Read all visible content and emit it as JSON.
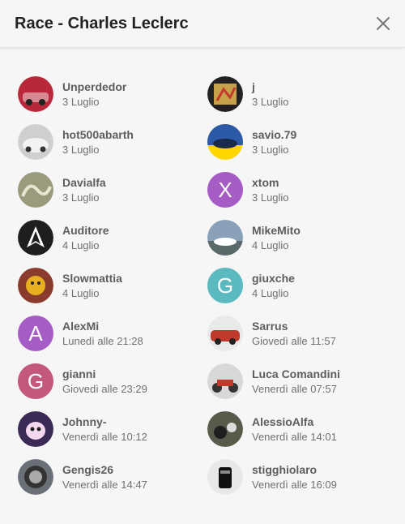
{
  "modal": {
    "title": "Race - Charles Leclerc",
    "close_icon": "close-icon"
  },
  "users": [
    {
      "name": "Unperdedor",
      "date": "3 Luglio",
      "avatar": "photo",
      "color": "#b8283a"
    },
    {
      "name": "j",
      "date": "3 Luglio",
      "avatar": "photo",
      "color": "#c8a24a"
    },
    {
      "name": "hot500abarth",
      "date": "3 Luglio",
      "avatar": "photo",
      "color": "#cfcfcf"
    },
    {
      "name": "savio.79",
      "date": "3 Luglio",
      "avatar": "photo",
      "color": "#2c5aa8"
    },
    {
      "name": "Davialfa",
      "date": "3 Luglio",
      "avatar": "photo",
      "color": "#9a9a7c"
    },
    {
      "name": "xtom",
      "date": "3 Luglio",
      "avatar": "letter",
      "letter": "X",
      "color": "#a55dc5"
    },
    {
      "name": "Auditore",
      "date": "4 Luglio",
      "avatar": "photo",
      "color": "#1f1f1f"
    },
    {
      "name": "MikeMito",
      "date": "4 Luglio",
      "avatar": "photo",
      "color": "#8aa0b8"
    },
    {
      "name": "Slowmattia",
      "date": "4 Luglio",
      "avatar": "photo",
      "color": "#8a3b2c"
    },
    {
      "name": "giuxche",
      "date": "4 Luglio",
      "avatar": "letter",
      "letter": "G",
      "color": "#5bbac0"
    },
    {
      "name": "AlexMi",
      "date": "Lunedì alle 21:28",
      "avatar": "letter",
      "letter": "A",
      "color": "#a55dc5"
    },
    {
      "name": "Sarrus",
      "date": "Giovedì alle 11:57",
      "avatar": "photo",
      "color": "#c0392b"
    },
    {
      "name": "gianni",
      "date": "Giovedì alle 23:29",
      "avatar": "letter",
      "letter": "G",
      "color": "#c4577d"
    },
    {
      "name": "Luca Comandini",
      "date": "Venerdì alle 07:57",
      "avatar": "photo",
      "color": "#d8d8d8"
    },
    {
      "name": "Johnny-",
      "date": "Venerdì alle 10:12",
      "avatar": "photo",
      "color": "#3a2a55"
    },
    {
      "name": "AlessioAlfa",
      "date": "Venerdì alle 14:01",
      "avatar": "photo",
      "color": "#5a5a4a"
    },
    {
      "name": "Gengis26",
      "date": "Venerdì alle 14:47",
      "avatar": "photo",
      "color": "#6a7078"
    },
    {
      "name": "stigghiolaro",
      "date": "Venerdì alle 16:09",
      "avatar": "photo",
      "color": "#e8e8e8"
    }
  ]
}
